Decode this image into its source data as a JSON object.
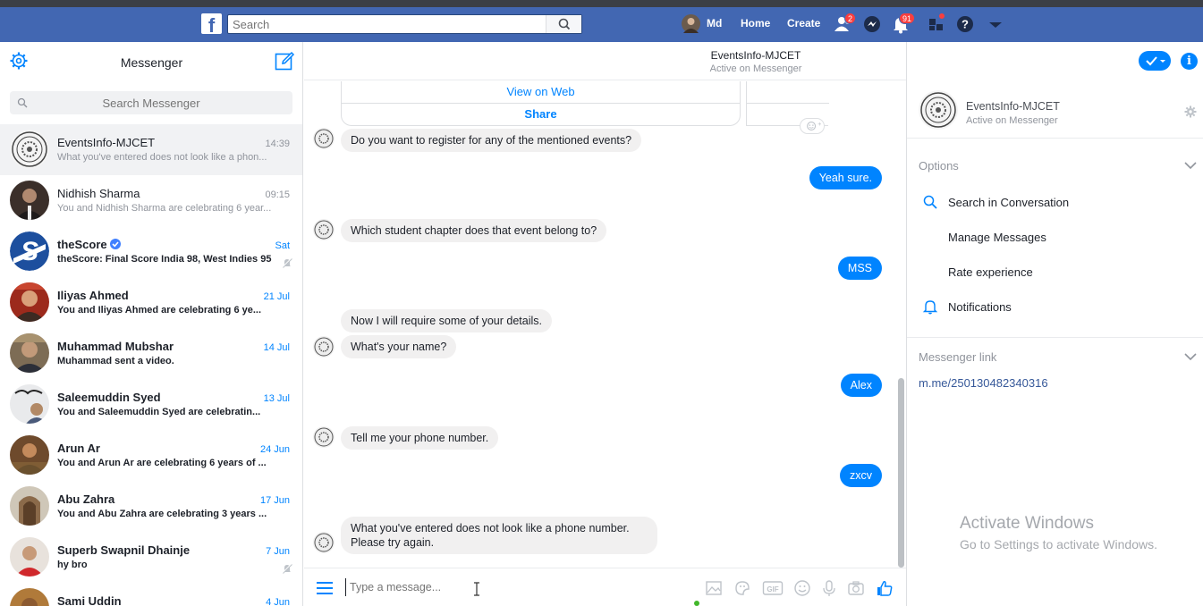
{
  "topbar": {
    "search_placeholder": "Search",
    "user_name": "Md",
    "home_label": "Home",
    "create_label": "Create",
    "friend_requests_badge": "2",
    "notifications_badge": "91"
  },
  "left": {
    "title": "Messenger",
    "search_placeholder": "Search Messenger",
    "conversations": [
      {
        "name": "EventsInfo-MJCET",
        "time": "14:39",
        "preview": "What you've entered does not look like a phon...",
        "unread": false
      },
      {
        "name": "Nidhish Sharma",
        "time": "09:15",
        "preview": "You and Nidhish Sharma are celebrating 6 year...",
        "unread": false
      },
      {
        "name": "theScore",
        "time": "Sat",
        "preview": "theScore: Final Score India 98, West Indies 95",
        "unread": true
      },
      {
        "name": "Iliyas Ahmed",
        "time": "21 Jul",
        "preview": "You and Iliyas Ahmed are celebrating 6 ye...",
        "unread": true
      },
      {
        "name": "Muhammad Mubshar",
        "time": "14 Jul",
        "preview": "Muhammad sent a video.",
        "unread": true
      },
      {
        "name": "Saleemuddin Syed",
        "time": "13 Jul",
        "preview": "You and Saleemuddin Syed are celebratin...",
        "unread": true
      },
      {
        "name": "Arun Ar",
        "time": "24 Jun",
        "preview": "You and Arun Ar are celebrating 6 years of ...",
        "unread": true
      },
      {
        "name": "Abu Zahra",
        "time": "17 Jun",
        "preview": "You and Abu Zahra are celebrating 3 years ...",
        "unread": true
      },
      {
        "name": "Superb Swapnil Dhainje",
        "time": "7 Jun",
        "preview": "hy bro",
        "unread": true
      },
      {
        "name": "Sami Uddin",
        "time": "4 Jun",
        "preview": "",
        "unread": true
      }
    ]
  },
  "chat": {
    "title": "EventsInfo-MJCET",
    "status": "Active on Messenger",
    "card_view_web": "View on Web",
    "card_share": "Share",
    "messages": [
      {
        "dir": "in",
        "text": "Do you want to register for any of the mentioned events?"
      },
      {
        "dir": "out",
        "text": "Yeah sure."
      },
      {
        "dir": "in",
        "text": "Which student chapter does that event belong to?"
      },
      {
        "dir": "out",
        "text": "MSS"
      },
      {
        "dir": "in",
        "text": "Now I will require some of your details."
      },
      {
        "dir": "in",
        "text": "What's your name?"
      },
      {
        "dir": "out",
        "text": "Alex"
      },
      {
        "dir": "in",
        "text": "Tell me your phone number."
      },
      {
        "dir": "out",
        "text": "zxcv"
      },
      {
        "dir": "in",
        "text": "What you've entered does not look like a phone number."
      },
      {
        "dir": "in",
        "text": "Please try again."
      }
    ],
    "composer_placeholder": "Type a message..."
  },
  "right": {
    "name": "EventsInfo-MJCET",
    "status": "Active on Messenger",
    "options_title": "Options",
    "options": [
      "Search in Conversation",
      "Manage Messages",
      "Rate experience",
      "Notifications"
    ],
    "link_title": "Messenger link",
    "link": "m.me/250130482340316"
  },
  "watermark": {
    "line1": "Activate Windows",
    "line2": "Go to Settings to activate Windows."
  },
  "colors": {
    "brand_blue": "#4267b2",
    "messenger_blue": "#0084ff",
    "badge_red": "#fa3e3e"
  }
}
